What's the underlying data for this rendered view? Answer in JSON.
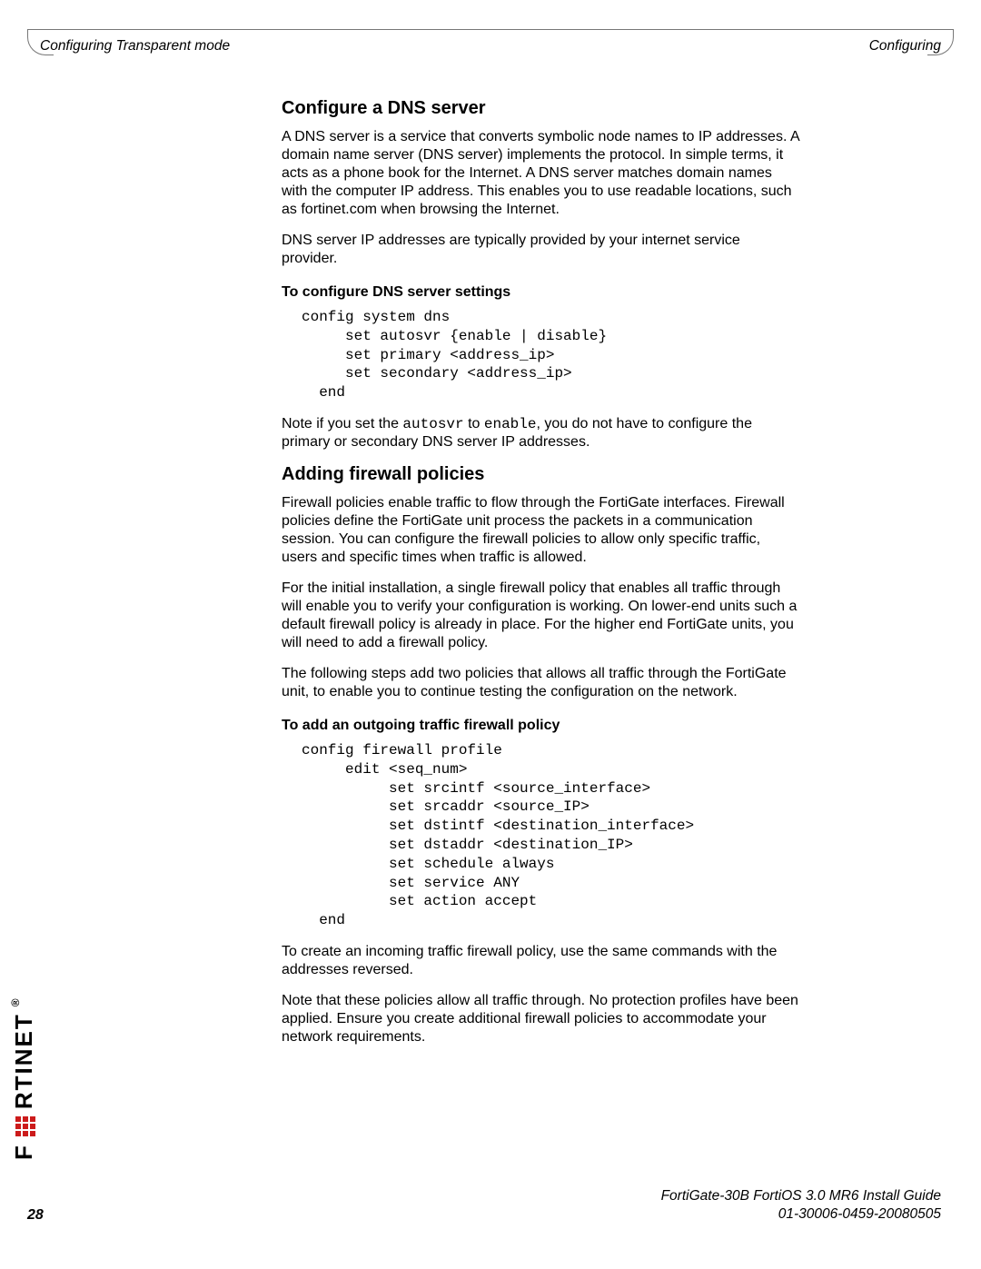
{
  "header": {
    "left": "Configuring Transparent mode",
    "right": "Configuring"
  },
  "sections": {
    "dns": {
      "heading": "Configure a DNS server",
      "p1": "A DNS server is a service that converts symbolic node names to IP addresses. A domain name server (DNS server) implements the protocol. In simple terms, it acts as a phone book for the Internet. A DNS server matches domain names with the computer IP address. This enables you to use readable locations, such as fortinet.com when browsing the Internet.",
      "p2": "DNS server IP addresses are typically provided by your internet service provider.",
      "sub1": "To configure DNS server settings",
      "code1": "config system dns\n     set autosvr {enable | disable}\n     set primary <address_ip>\n     set secondary <address_ip>\n  end",
      "note_pre": "Note if you set the ",
      "note_m1": "autosvr",
      "note_mid": " to ",
      "note_m2": "enable",
      "note_post": ", you do not have to configure the primary or secondary DNS server IP addresses."
    },
    "fw": {
      "heading": "Adding firewall policies",
      "p1": "Firewall policies enable traffic to flow through the FortiGate interfaces. Firewall policies define the FortiGate unit process the packets in a communication session. You can configure the firewall policies to allow only specific traffic, users and specific times when traffic is allowed.",
      "p2": "For the initial installation, a single firewall policy that enables all traffic through will enable you to verify your configuration is working. On lower-end units such a default firewall policy is already in place. For the higher end FortiGate units, you will need to add a firewall policy.",
      "p3": "The following steps add two policies that allows all traffic through the FortiGate unit, to enable you to continue testing the configuration on the network.",
      "sub1": "To add an outgoing traffic firewall policy",
      "code1": "config firewall profile\n     edit <seq_num>\n          set srcintf <source_interface>\n          set srcaddr <source_IP>\n          set dstintf <destination_interface>\n          set dstaddr <destination_IP>\n          set schedule always\n          set service ANY\n          set action accept\n  end",
      "p4": "To create an incoming traffic firewall policy, use the same commands with the addresses reversed.",
      "p5": "Note that these policies allow all traffic through. No protection profiles have been applied. Ensure you create additional firewall policies to accommodate your network requirements."
    }
  },
  "footer": {
    "pageNumber": "28",
    "line1": "FortiGate-30B FortiOS 3.0 MR6 Install Guide",
    "line2": "01-30006-0459-20080505"
  },
  "logo": {
    "pre": "F",
    "post": "RTINET",
    "dot": "®"
  }
}
